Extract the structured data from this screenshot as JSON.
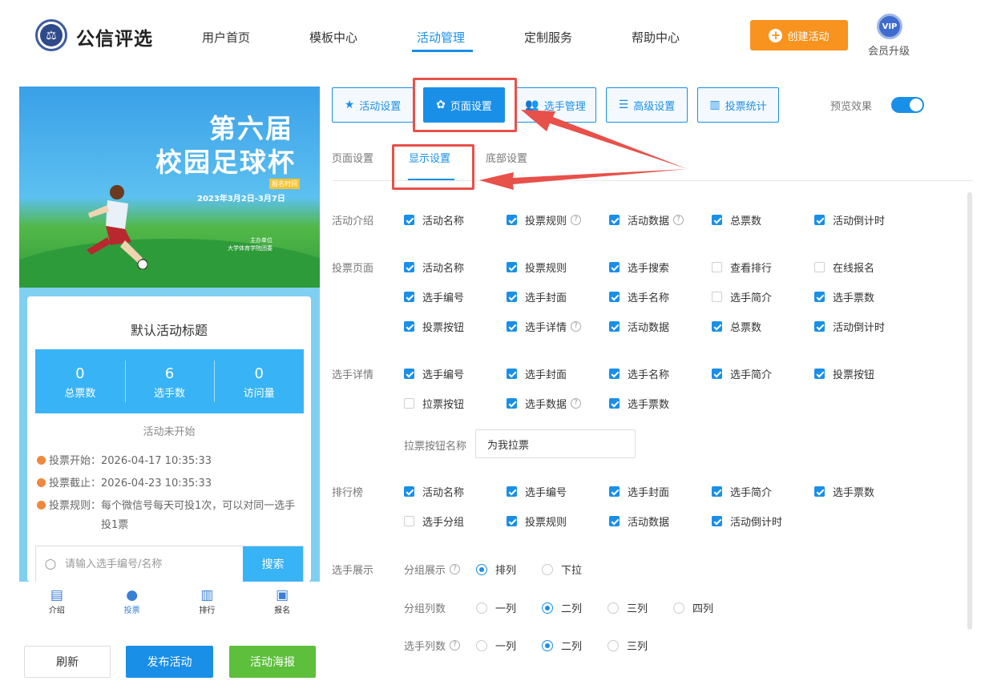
{
  "header": {
    "brand": "公信评选",
    "nav": [
      "用户首页",
      "模板中心",
      "活动管理",
      "定制服务",
      "帮助中心"
    ],
    "active_nav": "活动管理",
    "create_button": "创建活动",
    "vip_badge": "VIP",
    "vip_label": "会员升级"
  },
  "preview": {
    "banner": {
      "title_line1": "第六届",
      "title_line2": "校园足球杯",
      "tag": "报名时间",
      "date": "2023年3月2日-3月7日",
      "host_line1": "主办单位",
      "host_line2": "大学体育学院团委"
    },
    "activity_title": "默认活动标题",
    "stats": [
      {
        "value": "0",
        "label": "总票数"
      },
      {
        "value": "6",
        "label": "选手数"
      },
      {
        "value": "0",
        "label": "访问量"
      }
    ],
    "status": "活动未开始",
    "vote_start": "投票开始：2026-04-17 10:35:33",
    "vote_end": "投票截止：2026-04-23 10:35:33",
    "vote_rule_line1": "投票规则：每个微信号每天可投1次，可以对同一选手",
    "vote_rule_line2": "投1票",
    "search_placeholder": "请输入选手编号/名称",
    "search_button": "搜索",
    "tabbar": [
      "介绍",
      "投票",
      "排行",
      "报名"
    ]
  },
  "actions": {
    "refresh": "刷新",
    "publish": "发布活动",
    "poster": "活动海报"
  },
  "settings": {
    "tabs": [
      "活动设置",
      "页面设置",
      "选手管理",
      "高级设置",
      "投票统计"
    ],
    "active_tab": "页面设置",
    "preview_label": "预览效果",
    "preview_enabled": true,
    "subtabs": [
      "页面设置",
      "显示设置",
      "底部设置"
    ],
    "active_subtab": "显示设置",
    "sections": {
      "intro": "活动介绍",
      "vote_page": "投票页面",
      "player_detail": "选手详情",
      "ranking": "排行榜",
      "player_display": "选手展示"
    },
    "intro": [
      {
        "label": "活动名称",
        "checked": true
      },
      {
        "label": "投票规则",
        "checked": true
      },
      {
        "label": "活动数据",
        "checked": true
      },
      {
        "label": "总票数",
        "checked": true
      },
      {
        "label": "活动倒计时",
        "checked": true
      }
    ],
    "vote_page": [
      {
        "label": "活动名称",
        "checked": true
      },
      {
        "label": "投票规则",
        "checked": true
      },
      {
        "label": "选手搜索",
        "checked": true
      },
      {
        "label": "查看排行",
        "checked": false
      },
      {
        "label": "在线报名",
        "checked": false
      },
      {
        "label": "选手编号",
        "checked": true
      },
      {
        "label": "选手封面",
        "checked": true
      },
      {
        "label": "选手名称",
        "checked": true
      },
      {
        "label": "选手简介",
        "checked": false
      },
      {
        "label": "选手票数",
        "checked": true
      },
      {
        "label": "投票按钮",
        "checked": true
      },
      {
        "label": "选手详情",
        "checked": true
      },
      {
        "label": "活动数据",
        "checked": true
      },
      {
        "label": "总票数",
        "checked": true
      },
      {
        "label": "活动倒计时",
        "checked": true
      }
    ],
    "player_detail": [
      {
        "label": "选手编号",
        "checked": true
      },
      {
        "label": "选手封面",
        "checked": true
      },
      {
        "label": "选手名称",
        "checked": true
      },
      {
        "label": "选手简介",
        "checked": true
      },
      {
        "label": "投票按钮",
        "checked": true
      },
      {
        "label": "拉票按钮",
        "checked": false
      },
      {
        "label": "选手数据",
        "checked": true
      },
      {
        "label": "选手票数",
        "checked": true
      }
    ],
    "pull_button_label": "拉票按钮名称",
    "pull_button_value": "为我拉票",
    "ranking": [
      {
        "label": "活动名称",
        "checked": true
      },
      {
        "label": "选手编号",
        "checked": true
      },
      {
        "label": "选手封面",
        "checked": true
      },
      {
        "label": "选手简介",
        "checked": true
      },
      {
        "label": "选手票数",
        "checked": true
      },
      {
        "label": "选手分组",
        "checked": false
      },
      {
        "label": "投票规则",
        "checked": true
      },
      {
        "label": "活动数据",
        "checked": true
      },
      {
        "label": "活动倒计时",
        "checked": true
      }
    ],
    "group_display": {
      "label": "分组展示",
      "options": [
        "排列",
        "下拉"
      ],
      "selected": "排列"
    },
    "group_columns": {
      "label": "分组列数",
      "options": [
        "一列",
        "二列",
        "三列",
        "四列"
      ],
      "selected": "二列"
    },
    "player_columns": {
      "label": "选手列数",
      "options": [
        "一列",
        "二列",
        "三列"
      ],
      "selected": "二列"
    }
  },
  "colors": {
    "primary": "#1a8fe8",
    "create_button": "#f7931e",
    "poster_button": "#5dbf3c",
    "annotation": "#e8504a"
  }
}
